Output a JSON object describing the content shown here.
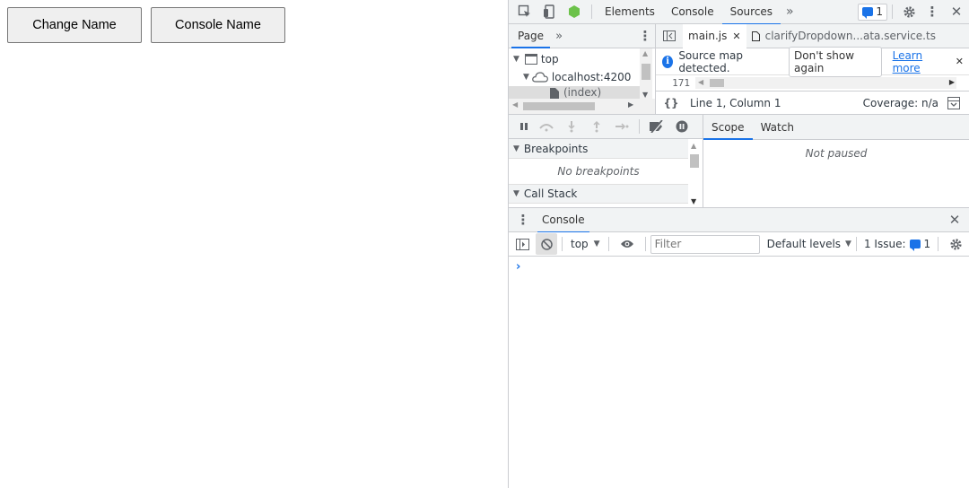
{
  "page": {
    "buttons": {
      "change_name": "Change Name",
      "console_name": "Console Name"
    }
  },
  "devtools": {
    "tabs": [
      "Elements",
      "Console",
      "Sources"
    ],
    "active_tab": "Sources",
    "more_tabs": "»",
    "issues_count": "1",
    "navigator": {
      "tab": "Page",
      "more": "»",
      "tree": [
        "top",
        "localhost:4200",
        "(index)"
      ]
    },
    "editor": {
      "tabs": [
        "main.js",
        "clarifyDropdown...ata.service.ts"
      ],
      "infobar": {
        "message": "Source map detected.",
        "dont_show": "Don't show again",
        "learn_more": "Learn more"
      },
      "line_number": "171",
      "status": {
        "format": "{}",
        "position": "Line 1, Column 1",
        "coverage": "Coverage: n/a"
      }
    },
    "debugger": {
      "breakpoints_title": "Breakpoints",
      "breakpoints_empty": "No breakpoints",
      "callstack_title": "Call Stack",
      "scope_tabs": [
        "Scope",
        "Watch"
      ],
      "scope_empty": "Not paused"
    },
    "console": {
      "drawer_tab": "Console",
      "context": "top",
      "filter_placeholder": "Filter",
      "levels": "Default levels",
      "issue_label": "1 Issue:",
      "issue_count": "1",
      "prompt": "›"
    }
  }
}
